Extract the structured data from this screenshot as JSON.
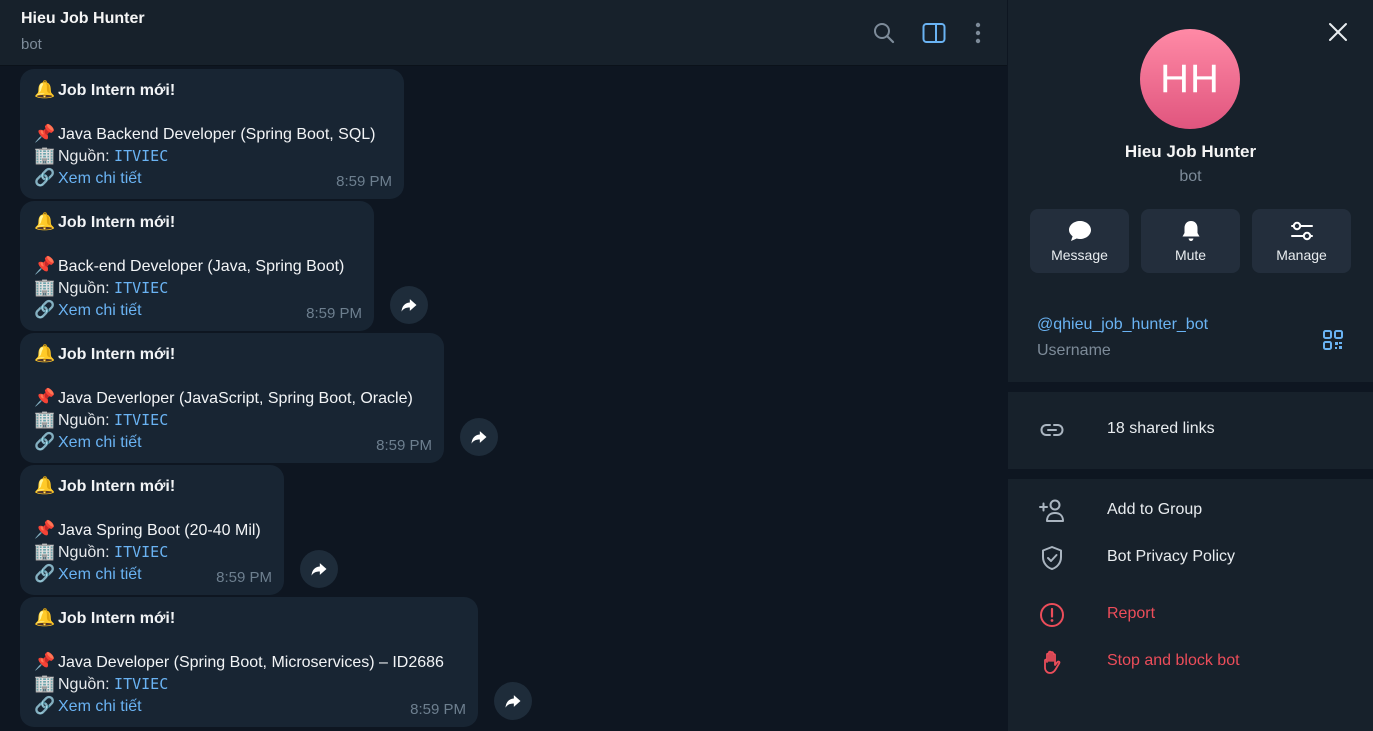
{
  "chat": {
    "title": "Hieu Job Hunter",
    "subtitle": "bot",
    "header_icons": [
      "search-icon",
      "sidebar-toggle-icon",
      "more-vertical-icon"
    ],
    "messages": [
      {
        "head_emoji": "🔔",
        "head": "Job Intern mới!",
        "job_emoji": "📌",
        "job": "Java Backend Developer (Spring Boot, SQL)",
        "src_emoji": "🏢",
        "src_label": "Nguồn: ",
        "src_value": "ITVIEC",
        "link_emoji": "🔗",
        "link": "Xem chi tiết",
        "time": "8:59 PM"
      },
      {
        "head_emoji": "🔔",
        "head": "Job Intern mới!",
        "job_emoji": "📌",
        "job": "Back-end Developer (Java, Spring Boot)",
        "src_emoji": "🏢",
        "src_label": "Nguồn: ",
        "src_value": "ITVIEC",
        "link_emoji": "🔗",
        "link": "Xem chi tiết",
        "time": "8:59 PM"
      },
      {
        "head_emoji": "🔔",
        "head": "Job Intern mới!",
        "job_emoji": "📌",
        "job": "Java Deverloper (JavaScript, Spring Boot, Oracle)",
        "src_emoji": "🏢",
        "src_label": "Nguồn: ",
        "src_value": "ITVIEC",
        "link_emoji": "🔗",
        "link": "Xem chi tiết",
        "time": "8:59 PM"
      },
      {
        "head_emoji": "🔔",
        "head": "Job Intern mới!",
        "job_emoji": "📌",
        "job": "Java Spring Boot (20-40 Mil)",
        "src_emoji": "🏢",
        "src_label": "Nguồn: ",
        "src_value": "ITVIEC",
        "link_emoji": "🔗",
        "link": "Xem chi tiết",
        "time": "8:59 PM"
      },
      {
        "head_emoji": "🔔",
        "head": "Job Intern mới!",
        "job_emoji": "📌",
        "job": "Java Developer (Spring Boot, Microservices) – ID2686",
        "src_emoji": "🏢",
        "src_label": "Nguồn: ",
        "src_value": "ITVIEC",
        "link_emoji": "🔗",
        "link": "Xem chi tiết",
        "time": "8:59 PM"
      }
    ]
  },
  "panel": {
    "avatar_initials": "HH",
    "name": "Hieu Job Hunter",
    "status": "bot",
    "actions": [
      {
        "label": "Message",
        "icon": "message-icon"
      },
      {
        "label": "Mute",
        "icon": "bell-icon"
      },
      {
        "label": "Manage",
        "icon": "sliders-icon"
      }
    ],
    "username": "@qhieu_job_hunter_bot",
    "username_label": "Username",
    "shared_links": "18 shared links",
    "add_to_group": "Add to Group",
    "privacy_policy": "Bot Privacy Policy",
    "report": "Report",
    "stop_block": "Stop and block bot"
  },
  "colors": {
    "background": "#0e1621",
    "surface": "#17212b",
    "bubble": "#182533",
    "accent": "#6ab3f3",
    "danger": "#ec4d5a"
  }
}
